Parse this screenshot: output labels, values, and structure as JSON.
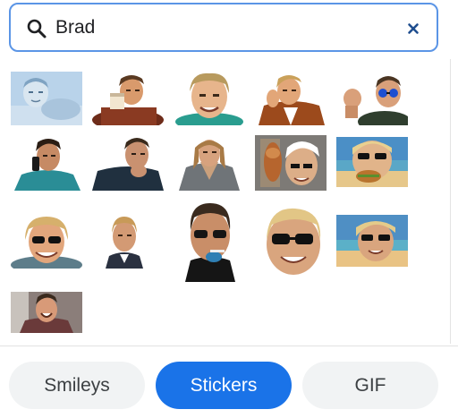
{
  "search": {
    "query": "Brad"
  },
  "stickers": [
    {
      "name": "sticker-pale-blue-lying"
    },
    {
      "name": "sticker-drinking-cup"
    },
    {
      "name": "sticker-smiling-face"
    },
    {
      "name": "sticker-suit-resting-chin"
    },
    {
      "name": "sticker-fist-sunglasses"
    },
    {
      "name": "sticker-phone-call"
    },
    {
      "name": "sticker-hand-on-chin"
    },
    {
      "name": "sticker-long-hair-warrior"
    },
    {
      "name": "sticker-doner-kebab"
    },
    {
      "name": "sticker-beach-sunglasses-burger"
    },
    {
      "name": "sticker-sunglasses-grin"
    },
    {
      "name": "sticker-portrait-headshot"
    },
    {
      "name": "sticker-smoking-sunglasses"
    },
    {
      "name": "sticker-big-head-sunglasses"
    },
    {
      "name": "sticker-beach-sunglasses"
    },
    {
      "name": "sticker-laughing-man"
    }
  ],
  "tabs": [
    {
      "label": "Smileys",
      "active": false
    },
    {
      "label": "Stickers",
      "active": true
    },
    {
      "label": "GIF",
      "active": false
    }
  ],
  "colors": {
    "accent": "#1a73e8",
    "search_border": "#5b95e6",
    "tab_inactive_bg": "#f1f3f4"
  },
  "icons": {
    "search": "search-icon",
    "clear": "close-icon"
  }
}
